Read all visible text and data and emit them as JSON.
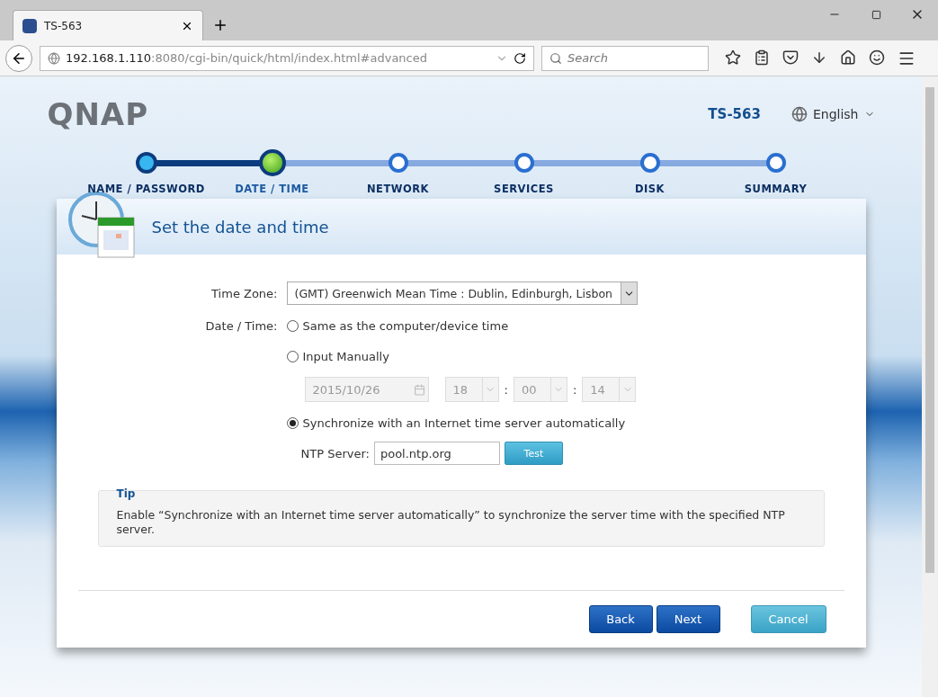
{
  "browser": {
    "tab": {
      "title": "TS-563"
    },
    "url": {
      "host": "192.168.1.110",
      "rest": ":8080/cgi-bin/quick/html/index.html#advanced"
    },
    "search": {
      "placeholder": "Search"
    }
  },
  "header": {
    "logo": "QNAP",
    "model": "TS-563",
    "language": "English"
  },
  "steps": [
    {
      "label": "NAME / PASSWORD",
      "done": true,
      "selected": false
    },
    {
      "label": "DATE / TIME",
      "done": false,
      "selected": true
    },
    {
      "label": "NETWORK",
      "done": false,
      "selected": false
    },
    {
      "label": "SERVICES",
      "done": false,
      "selected": false
    },
    {
      "label": "DISK",
      "done": false,
      "selected": false
    },
    {
      "label": "SUMMARY",
      "done": false,
      "selected": false
    }
  ],
  "card": {
    "title": "Set the date and time",
    "time_zone": {
      "label": "Time Zone:",
      "value": "(GMT) Greenwich Mean Time : Dublin, Edinburgh, Lisbon"
    },
    "date_time_label": "Date / Time:",
    "options": [
      {
        "label": "Same as the computer/device time",
        "selected": false
      },
      {
        "label": "Input Manually",
        "selected": false
      },
      {
        "label": "Synchronize with an Internet time server automatically",
        "selected": true
      }
    ],
    "manual": {
      "disabled": true,
      "date": "2015/10/26",
      "hour": "18",
      "minute": "00",
      "second": "14",
      "separators": [
        ":",
        ":"
      ]
    },
    "ntp": {
      "label": "NTP Server:",
      "value": "pool.ntp.org",
      "button": "Test"
    },
    "tip": {
      "title": "Tip",
      "text": "Enable “Synchronize with an Internet time server automatically” to synchronize the server time with the specified NTP server."
    },
    "buttons": [
      {
        "label": "Back",
        "kind": "primary"
      },
      {
        "label": "Next",
        "kind": "primary"
      },
      {
        "label": "Cancel",
        "kind": "secondary"
      }
    ]
  }
}
